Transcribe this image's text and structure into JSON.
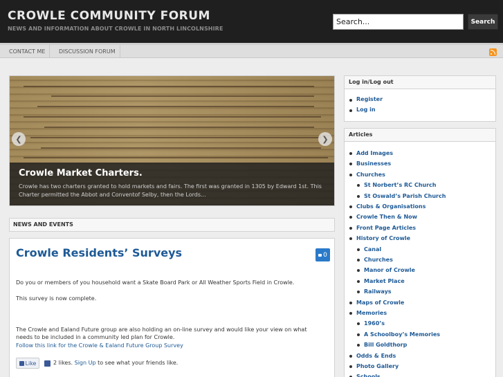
{
  "header": {
    "title": "CROWLE COMMUNITY FORUM",
    "tagline": "NEWS AND INFORMATION ABOUT CROWLE IN NORTH LINCOLNSHIRE",
    "search_placeholder": "Search...",
    "search_button": "Search"
  },
  "nav": {
    "items": [
      {
        "label": "CONTACT ME"
      },
      {
        "label": "DISCUSSION FORUM"
      }
    ],
    "rss_icon": "rss-icon"
  },
  "slider": {
    "title": "Crowle Market Charters.",
    "text": "Crowle has two charters granted to hold markets and fairs. The first was granted in 1305 by Edward 1st. This Charter permitted the Abbot and Conventof Selby, then the Lords..."
  },
  "news": {
    "section_label": "NEWS AND EVENTS",
    "post": {
      "title": "Crowle Residents’ Surveys",
      "comment_count": "0",
      "p1": "Do you or members of you household want a Skate Board Park or All Weather Sports Field in Crowle.",
      "p2": "This survey is now complete.",
      "p3": "The Crowle and Ealand Future group are also holding an on-line survey and would like your view on what needs to be included in a community led plan for Crowle.",
      "link": "Follow this link for the Crowle & Ealand Future Group Survey",
      "like_button": "Like",
      "likes_prefix": "2 likes.",
      "sign_up": "Sign Up",
      "likes_suffix": "to see what your friends like."
    }
  },
  "sidebar": {
    "login": {
      "title": "Log in/Log out",
      "items": [
        "Register",
        "Log in"
      ]
    },
    "articles": {
      "title": "Articles",
      "items": [
        {
          "label": "Add Images",
          "level": 1
        },
        {
          "label": "Businesses",
          "level": 1
        },
        {
          "label": "Churches",
          "level": 1
        },
        {
          "label": "St Norbert’s RC Church",
          "level": 2
        },
        {
          "label": "St Oswald’s Parish Church",
          "level": 2
        },
        {
          "label": "Clubs & Organisations",
          "level": 1
        },
        {
          "label": "Crowle Then & Now",
          "level": 1
        },
        {
          "label": "Front Page Articles",
          "level": 1
        },
        {
          "label": "History of Crowle",
          "level": 1
        },
        {
          "label": "Canal",
          "level": 2
        },
        {
          "label": "Churches",
          "level": 2
        },
        {
          "label": "Manor of Crowle",
          "level": 2
        },
        {
          "label": "Market Place",
          "level": 2
        },
        {
          "label": "Railways",
          "level": 2
        },
        {
          "label": "Maps of Crowle",
          "level": 1
        },
        {
          "label": "Memories",
          "level": 1
        },
        {
          "label": "1960’s",
          "level": 2
        },
        {
          "label": "A Schoolboy’s Memories",
          "level": 2
        },
        {
          "label": "Bill Goldthorp",
          "level": 2
        },
        {
          "label": "Odds & Ends",
          "level": 1
        },
        {
          "label": "Photo Gallery",
          "level": 1
        },
        {
          "label": "Schools",
          "level": 1
        }
      ]
    }
  }
}
